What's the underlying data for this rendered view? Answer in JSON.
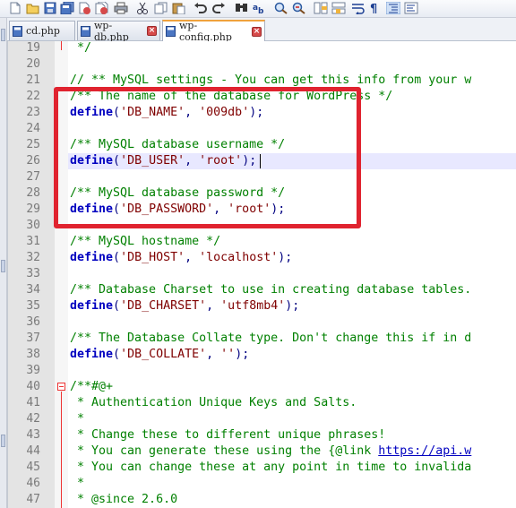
{
  "tabs": [
    {
      "label": "cd.php",
      "active": false
    },
    {
      "label": "wp-db.php",
      "active": false
    },
    {
      "label": "wp-config.php",
      "active": true
    }
  ],
  "gutter": {
    "line_numbers": [
      "19",
      "20",
      "21",
      "22",
      "23",
      "24",
      "25",
      "26",
      "27",
      "28",
      "29",
      "30",
      "31",
      "32",
      "33",
      "34",
      "35",
      "36",
      "37",
      "38",
      "39",
      "40",
      "41",
      "42",
      "43",
      "44",
      "45",
      "46",
      "47"
    ]
  },
  "editor": {
    "current_line": "26",
    "lines": [
      {
        "n": "19",
        "text": " */"
      },
      {
        "n": "20",
        "text": ""
      },
      {
        "n": "21",
        "text": "// ** MySQL settings - You can get this info from your w"
      },
      {
        "n": "22",
        "text": "/** The name of the database for WordPress */"
      },
      {
        "n": "23",
        "text": "define('DB_NAME', '009db');"
      },
      {
        "n": "24",
        "text": ""
      },
      {
        "n": "25",
        "text": "/** MySQL database username */"
      },
      {
        "n": "26",
        "text": "define('DB_USER', 'root');"
      },
      {
        "n": "27",
        "text": ""
      },
      {
        "n": "28",
        "text": "/** MySQL database password */"
      },
      {
        "n": "29",
        "text": "define('DB_PASSWORD', 'root');"
      },
      {
        "n": "30",
        "text": ""
      },
      {
        "n": "31",
        "text": "/** MySQL hostname */"
      },
      {
        "n": "32",
        "text": "define('DB_HOST', 'localhost');"
      },
      {
        "n": "33",
        "text": ""
      },
      {
        "n": "34",
        "text": "/** Database Charset to use in creating database tables."
      },
      {
        "n": "35",
        "text": "define('DB_CHARSET', 'utf8mb4');"
      },
      {
        "n": "36",
        "text": ""
      },
      {
        "n": "37",
        "text": "/** The Database Collate type. Don't change this if in d"
      },
      {
        "n": "38",
        "text": "define('DB_COLLATE', '');"
      },
      {
        "n": "39",
        "text": ""
      },
      {
        "n": "40",
        "text": "/**#@+"
      },
      {
        "n": "41",
        "text": " * Authentication Unique Keys and Salts."
      },
      {
        "n": "42",
        "text": " *"
      },
      {
        "n": "43",
        "text": " * Change these to different unique phrases!"
      },
      {
        "n": "44",
        "text": " * You can generate these using the {@link https://api.w"
      },
      {
        "n": "45",
        "text": " * You can change these at any point in time to invalida"
      },
      {
        "n": "46",
        "text": " *"
      },
      {
        "n": "47",
        "text": " * @since 2.6.0"
      }
    ]
  },
  "toolbar": {
    "icons": [
      "new-file-icon",
      "open-file-icon",
      "save-icon",
      "save-all-icon",
      "close-icon",
      "close-all-icon",
      "print-icon",
      "cut-icon",
      "copy-icon",
      "paste-icon",
      "undo-icon",
      "redo-icon",
      "find-icon",
      "replace-icon",
      "zoom-in-icon",
      "zoom-out-icon",
      "sync-vertical-icon",
      "sync-horizontal-icon",
      "word-wrap-icon",
      "show-all-chars-icon",
      "indent-guide-icon",
      "doc-map-icon"
    ]
  },
  "colors": {
    "annotation_red": "#e0232f",
    "comment": "#008000",
    "keyword": "#0000c0",
    "string": "#7f0000",
    "current_line_bg": "#e8e8ff",
    "active_tab_accent": "#f0a23c"
  }
}
